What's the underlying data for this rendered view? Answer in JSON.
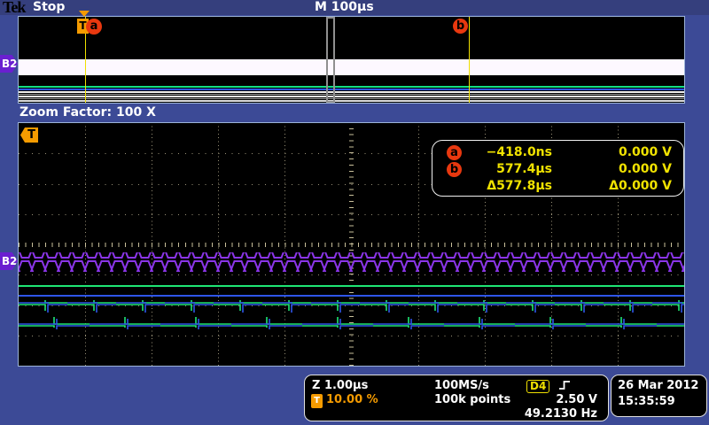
{
  "header": {
    "brand": "Tek",
    "status": "Stop",
    "timebase": "M 100µs"
  },
  "overview": {
    "bus_label": "B2",
    "trigger_marker": "T",
    "cursor_a": "a",
    "cursor_b": "b"
  },
  "zoom_bar": {
    "label": "Zoom Factor: 100 X"
  },
  "main_view": {
    "bus_label": "B2",
    "trigger_marker": "T"
  },
  "cursors": {
    "a": {
      "label": "a",
      "time": "−418.0ns",
      "voltage": "0.000 V"
    },
    "b": {
      "label": "b",
      "time": "577.4µs",
      "voltage": "0.000 V"
    },
    "delta": {
      "time": "Δ577.8µs",
      "voltage": "Δ0.000 V"
    }
  },
  "status": {
    "zoom_scale": "Z 1.00µs",
    "sample_rate": "100MS/s",
    "trigger_source": "D4",
    "trigger_icon": "T",
    "trigger_position": "10.00 %",
    "record_length": "100k points",
    "trigger_level": "2.50 V",
    "trigger_frequency": "49.2130 Hz",
    "date": "26 Mar 2012",
    "time": "15:35:59"
  },
  "colors": {
    "background_blue": "#3c4a96",
    "accent_orange": "#f59b00",
    "cursor_yellow": "#f0e000",
    "marker_red": "#e8380f",
    "bus_purple": "#8a35e8",
    "trace_green": "#1ee574",
    "trace_blue": "#2e55e8",
    "graticule": "#9a9278"
  },
  "waveforms": {
    "main": [
      {
        "id": "bus-b2",
        "style": "bus",
        "color": "#8a35e8"
      },
      {
        "id": "trace-green-flat",
        "style": "flat",
        "color": "#1ee574"
      },
      {
        "id": "trace-blue-flat",
        "style": "flat",
        "color": "#2e55e8"
      },
      {
        "id": "trace-green-square-fast",
        "style": "square",
        "color": "#1ee574"
      },
      {
        "id": "trace-blue-square-fast",
        "style": "square",
        "color": "#2e55e8"
      },
      {
        "id": "trace-green-square-slow",
        "style": "square",
        "color": "#1ee574"
      },
      {
        "id": "trace-blue-square-slow",
        "style": "square",
        "color": "#2e55e8"
      }
    ]
  }
}
